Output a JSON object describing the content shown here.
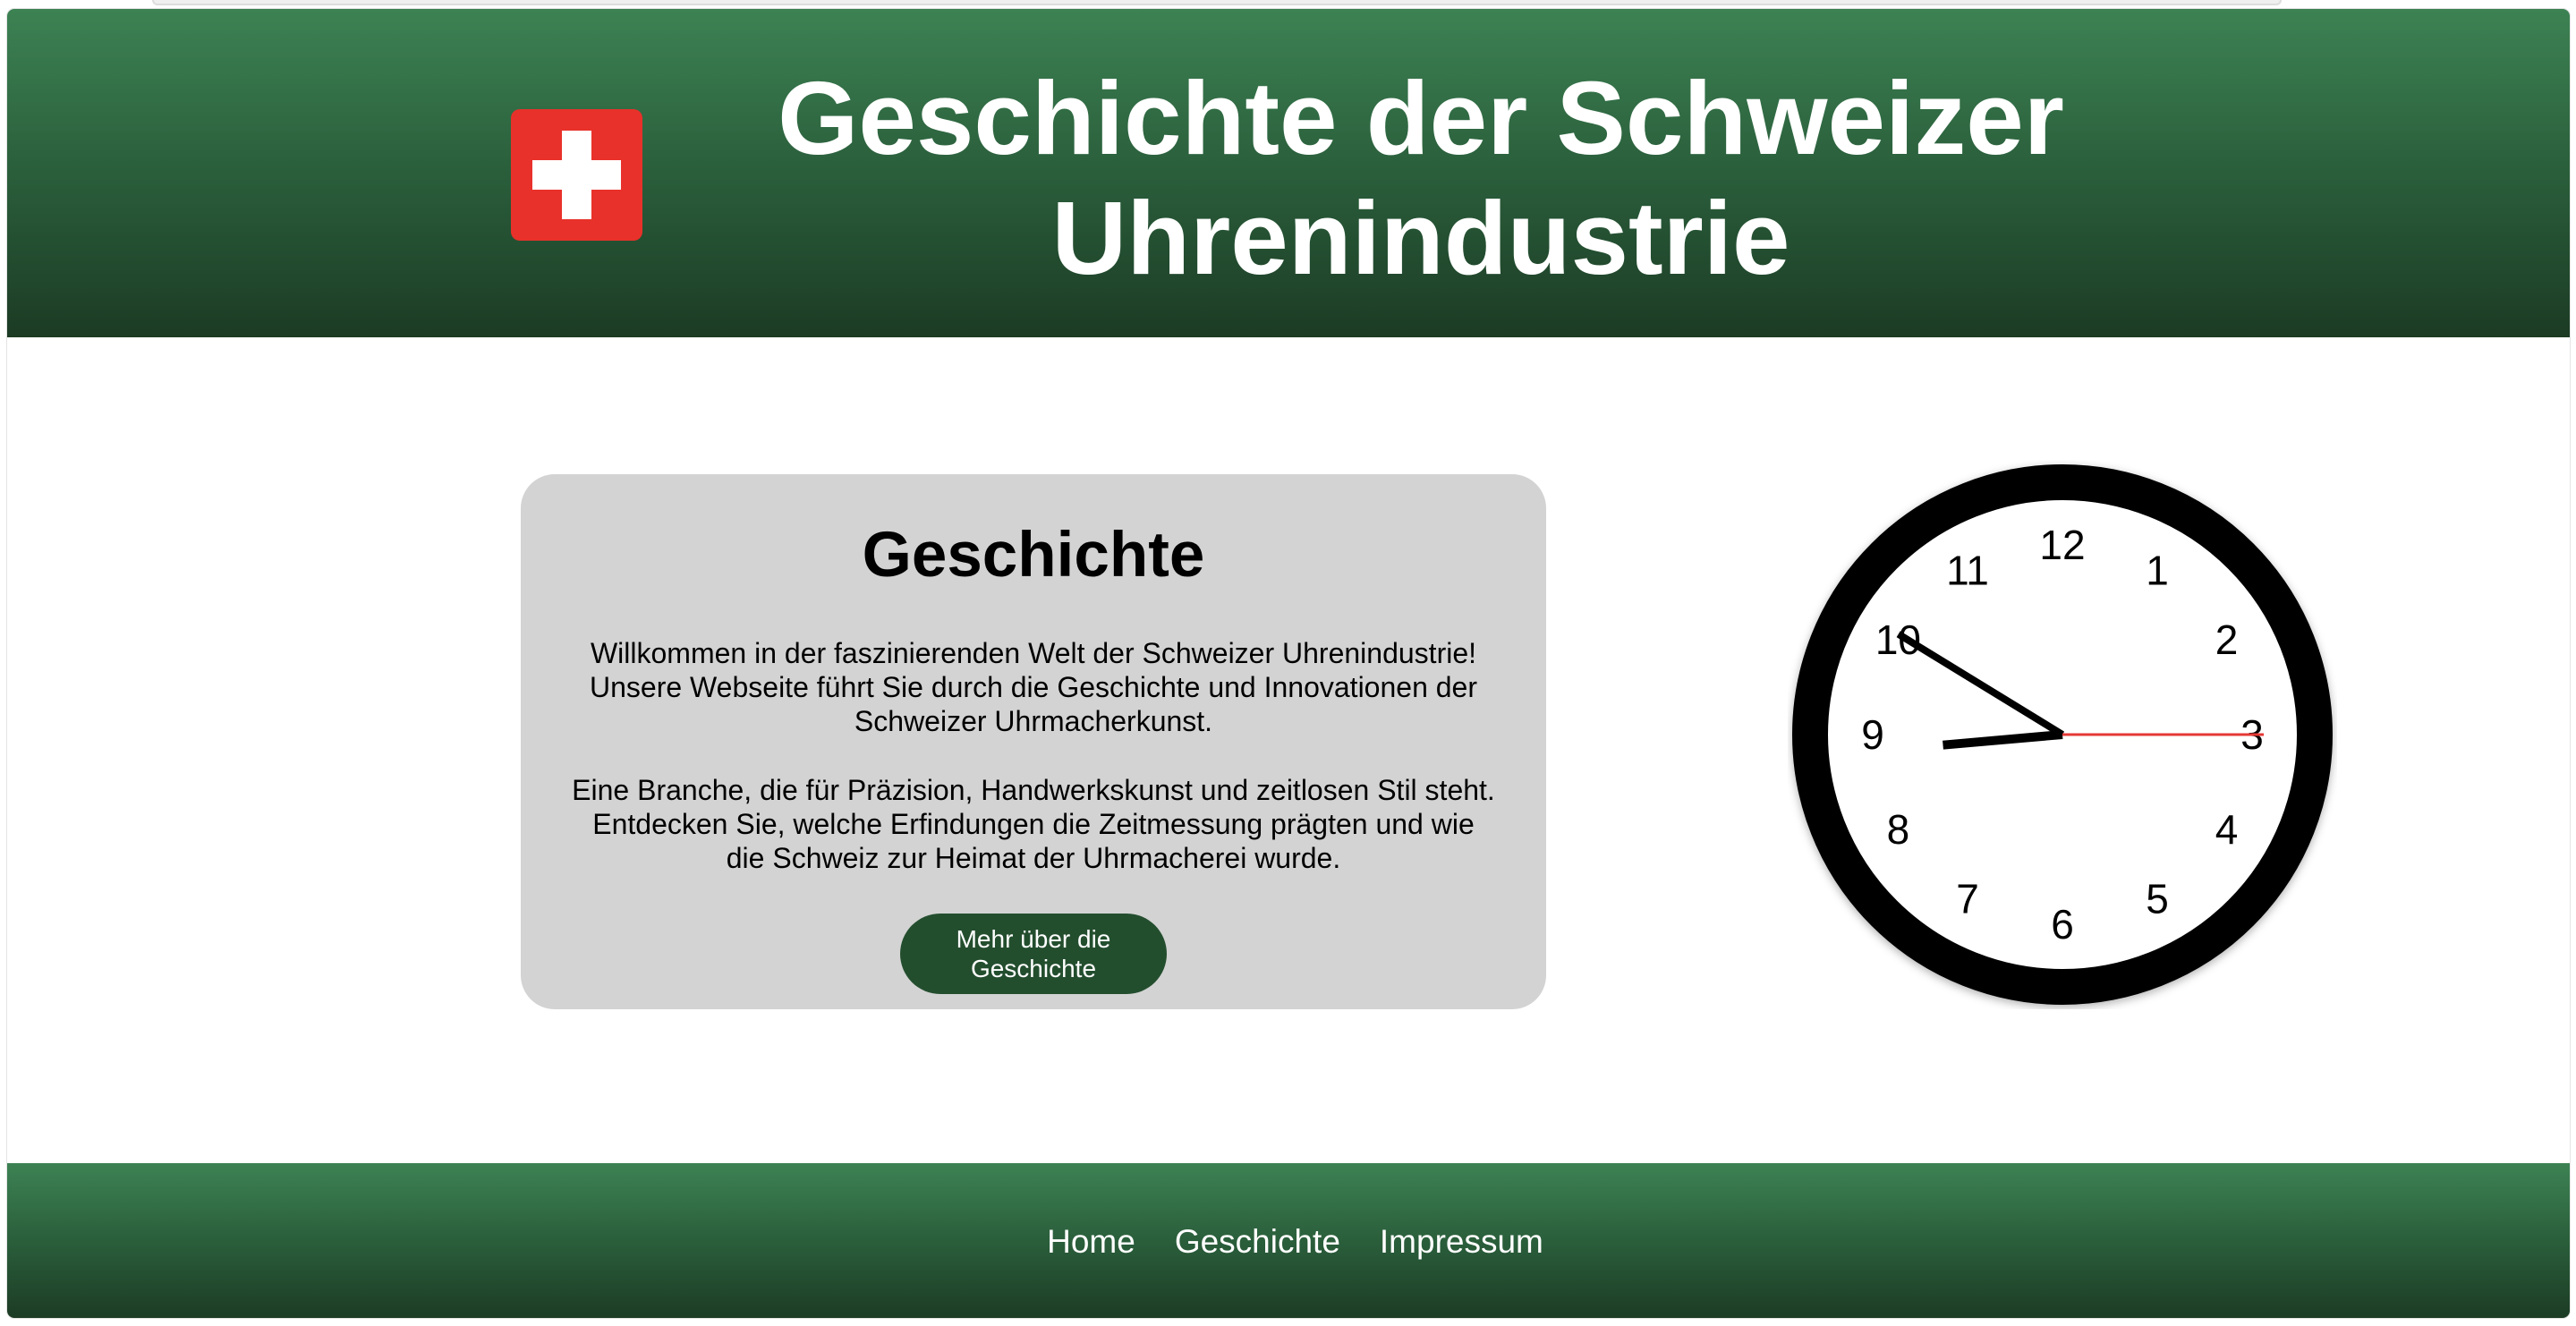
{
  "header": {
    "title": "Geschichte der Schweizer Uhrenindustrie",
    "flag_color": "#e8312a",
    "gradient_top": "#3d8253",
    "gradient_bottom": "#1c3b24"
  },
  "main": {
    "heading": "Geschichte",
    "paragraph_1": "Willkommen in der faszinierenden Welt der Schweizer Uhrenindustrie! Unsere Webseite führt Sie durch die Geschichte und Innovationen der Schweizer Uhrmacherkunst.",
    "paragraph_2": "Eine Branche, die für Präzision, Handwerkskunst und zeitlosen Stil steht. Entdecken Sie, welche Erfindungen die Zeitmessung prägten und wie die Schweiz zur Heimat der Uhrmacherei wurde.",
    "button_label": "Mehr über die Geschichte",
    "button_color": "#234e2e"
  },
  "clock": {
    "numbers": [
      "12",
      "1",
      "2",
      "3",
      "4",
      "5",
      "6",
      "7",
      "8",
      "9",
      "10",
      "11"
    ],
    "time": {
      "hour": 8,
      "minute": 50,
      "second": 15
    },
    "second_hand_color": "#e53935"
  },
  "footer": {
    "links": [
      "Home",
      "Geschichte",
      "Impressum"
    ]
  }
}
